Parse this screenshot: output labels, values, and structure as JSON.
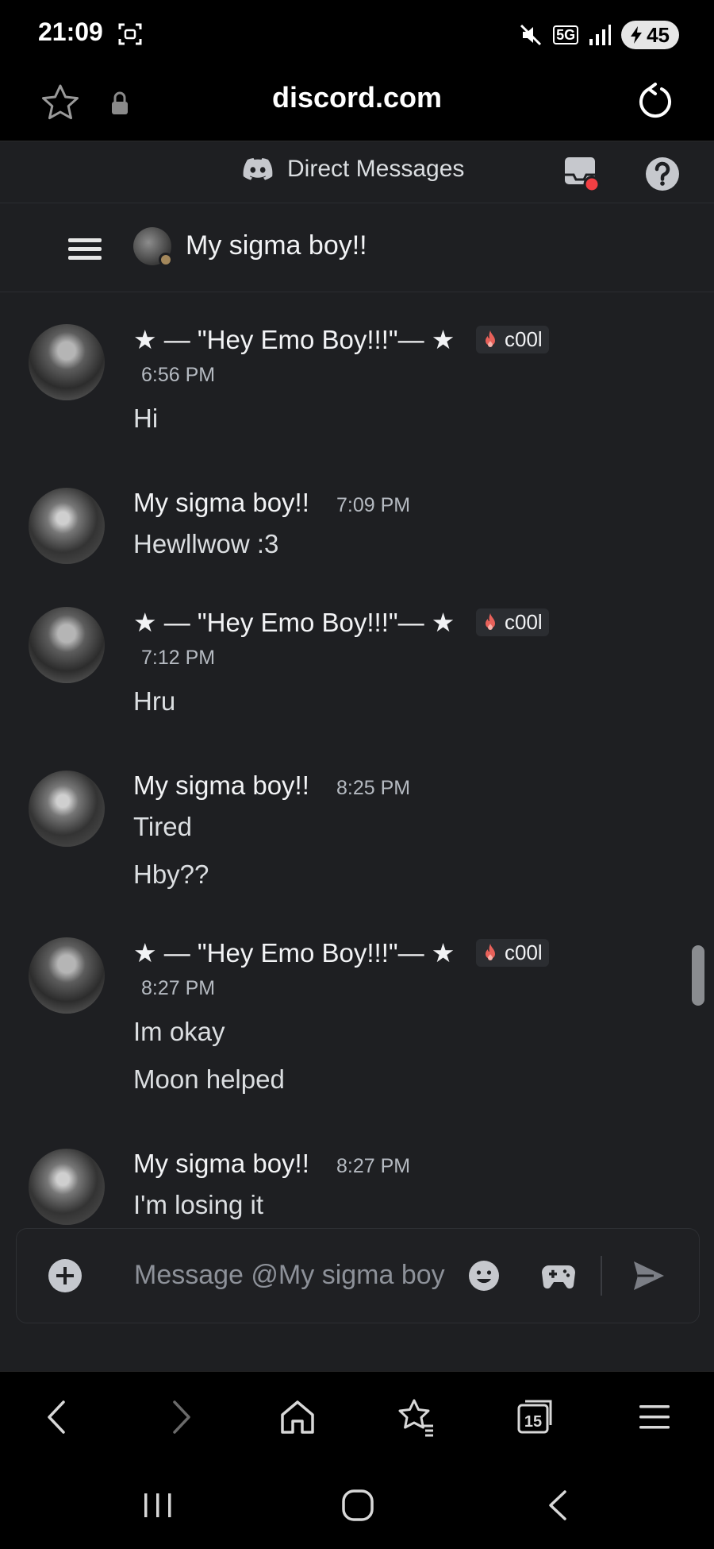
{
  "status_bar": {
    "time": "21:09",
    "network": "5G",
    "battery": "45"
  },
  "browser": {
    "url": "discord.com"
  },
  "discord": {
    "section_title": "Direct Messages",
    "channel_name": "My sigma boy!!",
    "colors": {
      "background": "#1e1f22",
      "notification": "#f23f43",
      "text": "#dbdee1",
      "muted": "#b5bac1"
    },
    "messages": [
      {
        "author": "★ — \"Hey Emo Boy!!!\"— ★",
        "tag": "c00l",
        "time": "6:56 PM",
        "lines": [
          "Hi"
        ]
      },
      {
        "author": "My sigma boy!!",
        "time": "7:09 PM",
        "lines": [
          "Hewllwow :3"
        ]
      },
      {
        "author": "★ — \"Hey Emo Boy!!!\"— ★",
        "tag": "c00l",
        "time": "7:12 PM",
        "lines": [
          "Hru"
        ]
      },
      {
        "author": "My sigma boy!!",
        "time": "8:25 PM",
        "lines": [
          "Tired",
          "Hby??"
        ]
      },
      {
        "author": "★ — \"Hey Emo Boy!!!\"— ★",
        "tag": "c00l",
        "time": "8:27 PM",
        "lines": [
          "Im okay",
          "Moon helped"
        ]
      },
      {
        "author": "My sigma boy!!",
        "time": "8:27 PM",
        "lines": [
          "I'm losing it"
        ]
      }
    ],
    "composer": {
      "placeholder": "Message @My sigma boy"
    }
  },
  "browser_nav": {
    "tab_count": "15"
  }
}
